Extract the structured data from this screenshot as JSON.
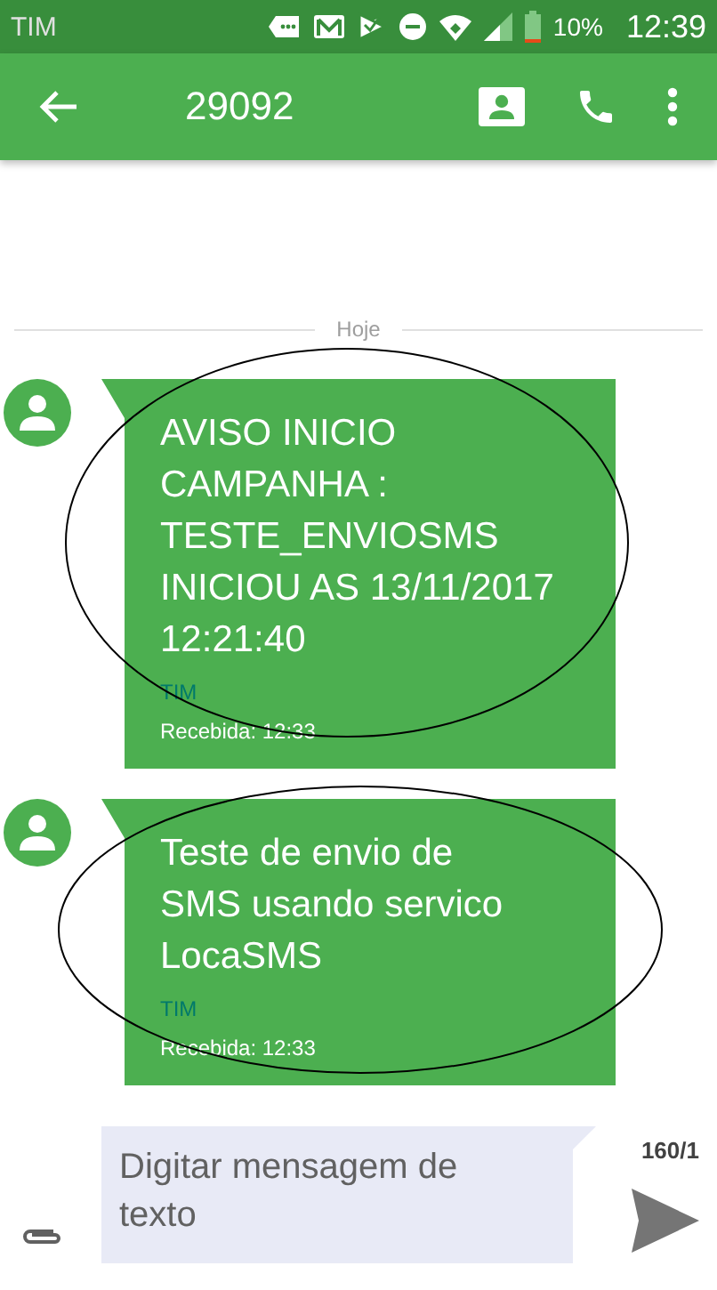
{
  "status_bar": {
    "carrier": "TIM",
    "battery": "10%",
    "time": "12:39"
  },
  "toolbar": {
    "title": "29092"
  },
  "date_divider": "Hoje",
  "messages": [
    {
      "text": "AVISO INICIO CAMPANHA : TESTE_ENVIOSMS INICIOU AS 13/11/2017 12:21:40",
      "sender": "TIM",
      "status": "Recebida: 12:33",
      "circled": true
    },
    {
      "text": "Teste de envio de\nSMS usando servico\nLocaSMS",
      "sender": "TIM",
      "status": "Recebida: 12:33",
      "circled": true
    }
  ],
  "composer": {
    "placeholder": "Digitar mensagem de texto",
    "counter": "160/1"
  }
}
